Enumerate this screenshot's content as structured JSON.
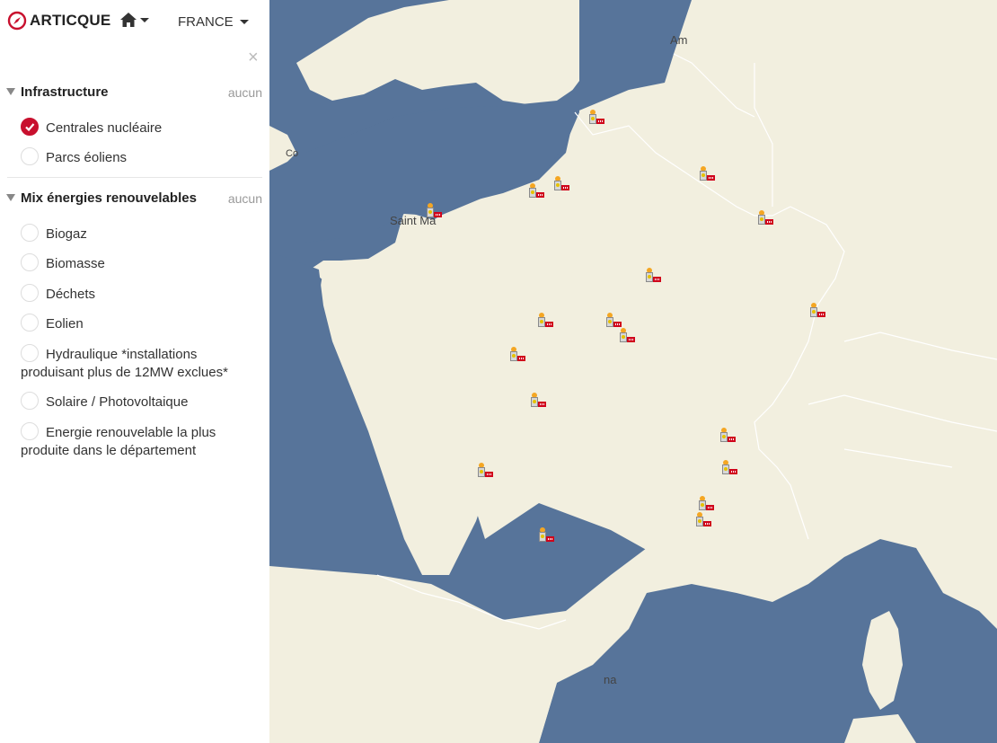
{
  "brand": {
    "name": "ARTICQUE",
    "accent": "#c8102e"
  },
  "nav": {
    "region_label": "FRANCE"
  },
  "sections": [
    {
      "title": "Infrastructure",
      "clear_label": "aucun",
      "items": [
        {
          "label": "Centrales nucléaire",
          "checked": true
        },
        {
          "label": "Parcs éoliens",
          "checked": false
        }
      ]
    },
    {
      "title": "Mix énergies renouvelables",
      "clear_label": "aucun",
      "items": [
        {
          "label": "Biogaz",
          "checked": false
        },
        {
          "label": "Biomasse",
          "checked": false
        },
        {
          "label": "Déchets",
          "checked": false
        },
        {
          "label": "Eolien",
          "checked": false
        },
        {
          "label": "Hydraulique *installations produisant plus de 12MW exclues*",
          "checked": false
        },
        {
          "label": "Solaire / Photovoltaique",
          "checked": false
        },
        {
          "label": "Energie renouvelable la plus produite dans le département",
          "checked": false
        }
      ]
    }
  ],
  "map": {
    "colors": {
      "sea": "#57749a",
      "land": "#f2efdf",
      "border": "#ffffff"
    },
    "place_labels": [
      "Am",
      "Co",
      "Saint Ma",
      "na"
    ],
    "marker_icon": "nuclear-plant-icon",
    "nuclear_plant_count": 19
  }
}
